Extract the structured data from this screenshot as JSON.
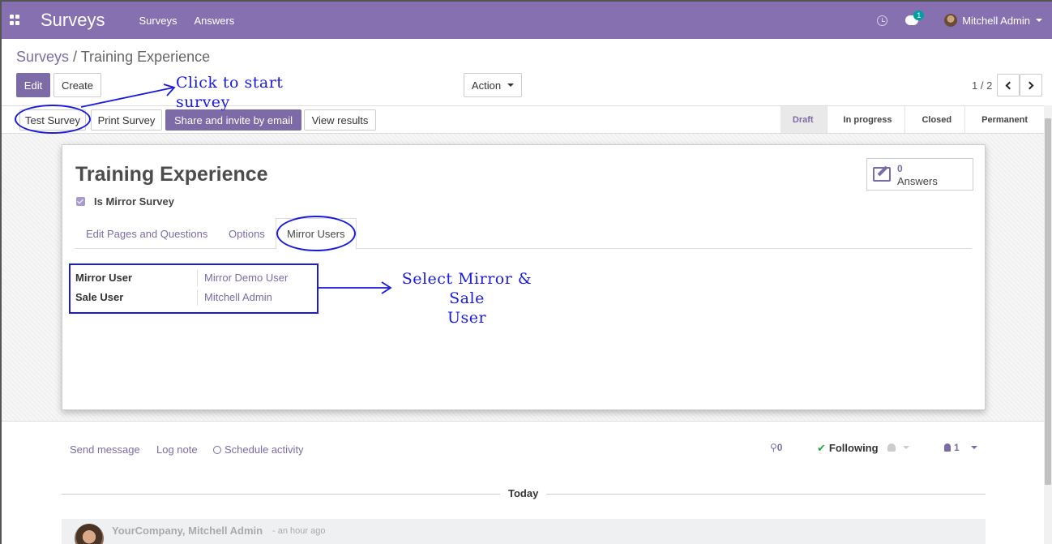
{
  "navbar": {
    "app_title": "Surveys",
    "menu": [
      "Surveys",
      "Answers"
    ],
    "chat_badge": "1",
    "user_name": "Mitchell Admin"
  },
  "breadcrumb": {
    "parent": "Surveys",
    "separator": " / ",
    "current": "Training Experience"
  },
  "control": {
    "edit_label": "Edit",
    "create_label": "Create",
    "action_label": "Action",
    "pager": "1 / 2"
  },
  "header_buttons": {
    "test": "Test Survey",
    "print": "Print Survey",
    "share": "Share and invite by email",
    "results": "View results"
  },
  "stages": [
    "Draft",
    "In progress",
    "Closed",
    "Permanent"
  ],
  "stage_active": "Draft",
  "form": {
    "title": "Training Experience",
    "checkbox_label": "Is Mirror Survey",
    "stat_value": "0",
    "stat_label": "Answers",
    "tabs": [
      "Edit Pages and Questions",
      "Options",
      "Mirror Users"
    ],
    "fields": [
      {
        "label": "Mirror User",
        "value": "Mirror Demo User"
      },
      {
        "label": "Sale User",
        "value": "Mitchell Admin"
      }
    ]
  },
  "annotations": {
    "start": "Click to start survey",
    "select_line1": "Select Mirror & Sale",
    "select_line2": "User"
  },
  "chatter": {
    "send": "Send message",
    "log": "Log note",
    "schedule": "Schedule activity",
    "attachments": "0",
    "following": "Following",
    "followers": "1",
    "today": "Today",
    "author": "YourCompany, Mitchell Admin",
    "time": "- an hour ago"
  },
  "colors": {
    "brand": "#8670b0",
    "link": "#7c6ba6",
    "annotation": "#1a1adb"
  }
}
